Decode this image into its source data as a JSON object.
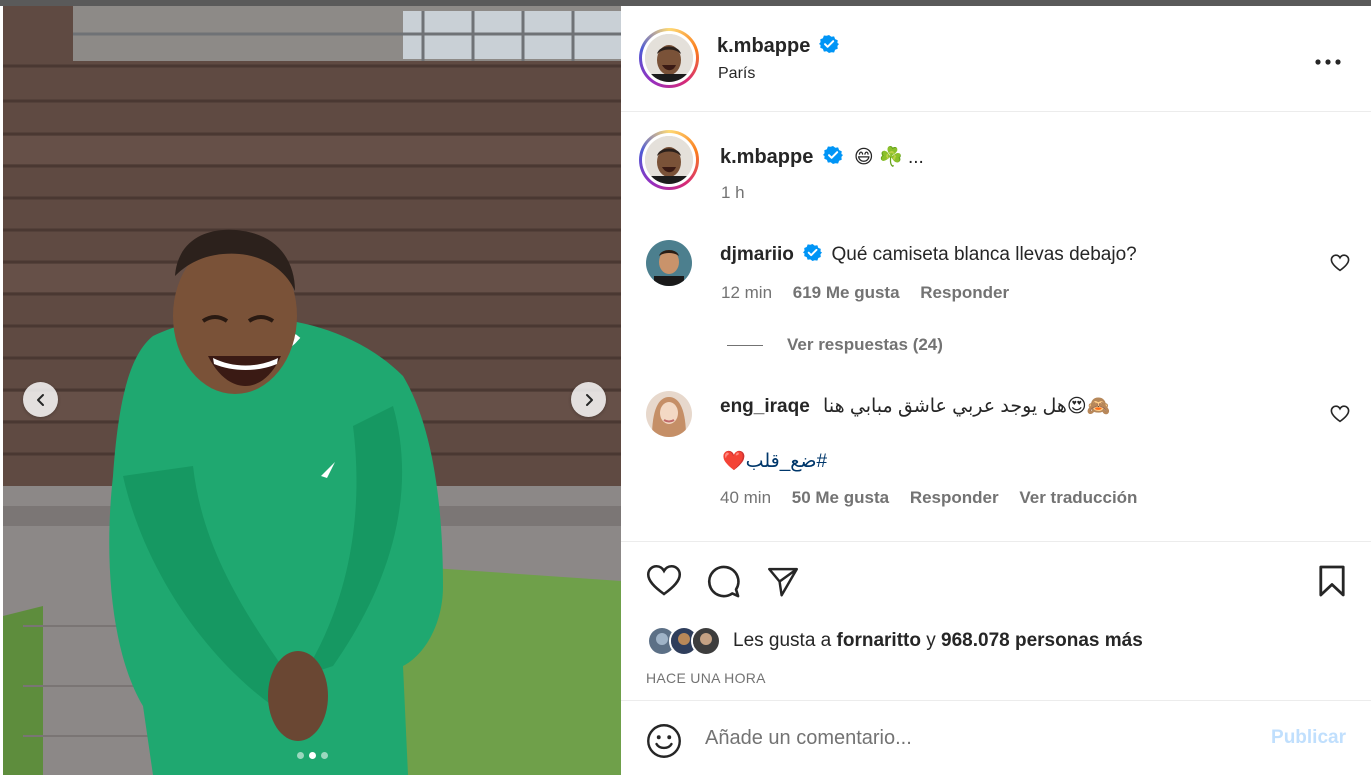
{
  "post": {
    "username": "k.mbappe",
    "location": "París"
  },
  "caption": {
    "username": "k.mbappe",
    "text": "😄 ☘️ ...",
    "time": "1 h"
  },
  "comments": [
    {
      "username": "djmariio",
      "text": "Qué camiseta blanca llevas debajo?",
      "time": "12 min",
      "likes": "619 Me gusta",
      "reply": "Responder",
      "view_replies": "Ver respuestas (24)"
    },
    {
      "username": "eng_iraqe",
      "text": "🙈😍هل يوجد عربي عاشق مبابي هنا",
      "text2": "#ضع_قلب",
      "text2_emoji": "❤️",
      "time": "40 min",
      "likes": "50 Me gusta",
      "reply": "Responder",
      "translate": "Ver traducción"
    }
  ],
  "likes": {
    "prefix": "Les gusta a",
    "user": "fornaritto",
    "joiner": "y",
    "count": "968.078 personas más"
  },
  "time_ago": "HACE UNA HORA",
  "composer": {
    "placeholder": "Añade un comentario...",
    "publish": "Publicar"
  },
  "carousel": {
    "current_slide": 2,
    "total_slides": 3
  },
  "icons": {
    "verified": "verified-badge-icon",
    "more": "more-options-icon",
    "like": "heart-icon",
    "comment": "comment-icon",
    "share": "paper-plane-icon",
    "save": "bookmark-icon",
    "emoji": "emoji-smile-icon"
  },
  "colors": {
    "verified_blue": "#0095f6",
    "hashtag": "#00376b",
    "publish_disabled": "#c0dffd",
    "muted_text": "#737373"
  }
}
